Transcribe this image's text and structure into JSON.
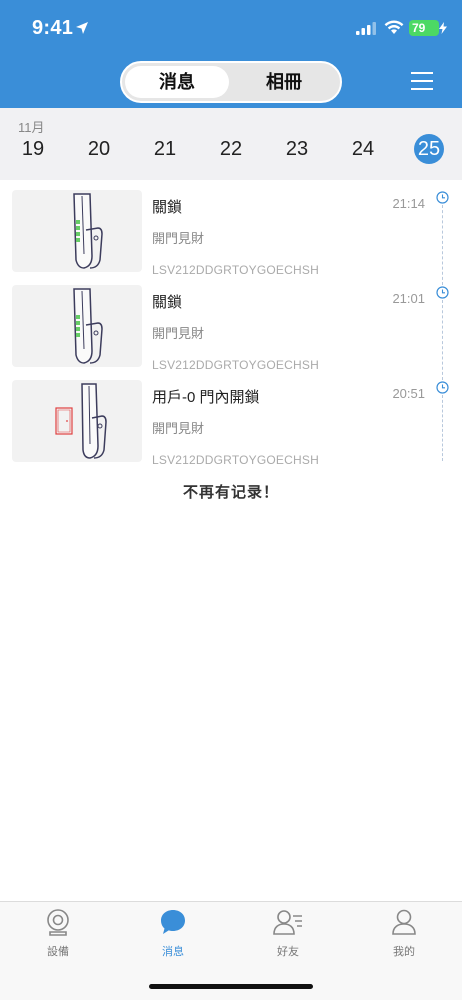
{
  "status_bar": {
    "time": "9:41",
    "battery": "79"
  },
  "header": {
    "tabs": [
      {
        "label": "消息",
        "active": true
      },
      {
        "label": "相冊",
        "active": false
      }
    ],
    "menu_icon": "hamburger-menu-icon"
  },
  "date_strip": {
    "month": "11月",
    "days": [
      "19",
      "20",
      "21",
      "22",
      "23",
      "24",
      "25"
    ],
    "selected_day": "25"
  },
  "records": [
    {
      "title": "關鎖",
      "subtitle": "開門見財",
      "device_id": "LSV212DDGRTOYGOECHSH",
      "time": "21:14"
    },
    {
      "title": "關鎖",
      "subtitle": "開門見財",
      "device_id": "LSV212DDGRTOYGOECHSH",
      "time": "21:01"
    },
    {
      "title": "用戶-0 門內開鎖",
      "subtitle": "開門見財",
      "device_id": "LSV212DDGRTOYGOECHSH",
      "time": "20:51"
    }
  ],
  "end_message": "不再有记录！",
  "tabbar": {
    "items": [
      {
        "label": "設備",
        "icon": "camera-device-icon",
        "active": false
      },
      {
        "label": "消息",
        "icon": "chat-bubble-icon",
        "active": true
      },
      {
        "label": "好友",
        "icon": "friends-list-icon",
        "active": false
      },
      {
        "label": "我的",
        "icon": "person-icon",
        "active": false
      }
    ]
  },
  "colors": {
    "primary": "#3a8ed8",
    "battery": "#4cd964",
    "lock_green": "#66cc66",
    "door_red": "#e04040"
  }
}
